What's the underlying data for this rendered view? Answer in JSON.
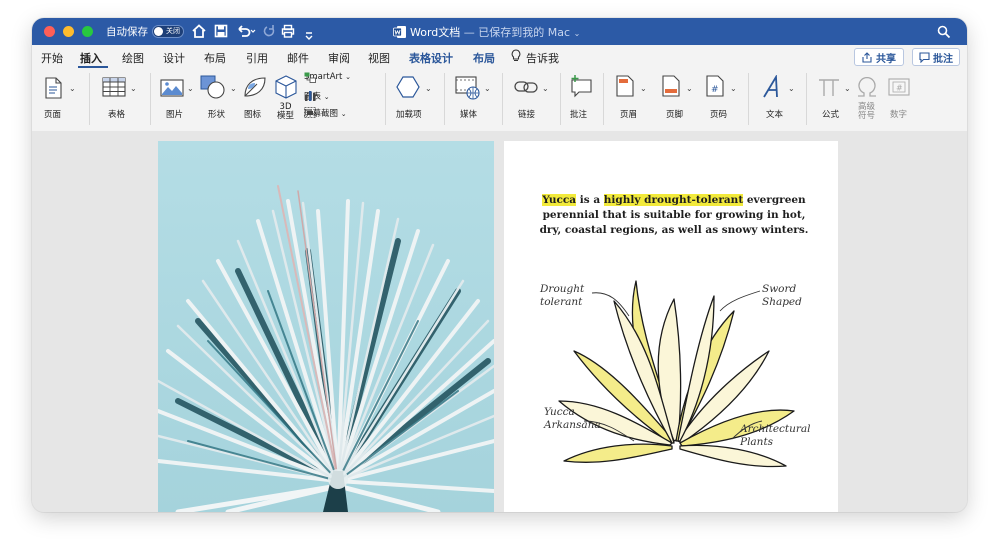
{
  "titlebar": {
    "autosave_label": "自动保存",
    "autosave_toggle": "关闭",
    "doc_name": "Word文档",
    "doc_status": " — 已保存到我的 Mac",
    "colors": {
      "bar": "#2c5aa6",
      "close": "#ff5f57",
      "minimize": "#febc2e",
      "zoom": "#28c840"
    }
  },
  "tabs": [
    {
      "label": "开始"
    },
    {
      "label": "插入"
    },
    {
      "label": "绘图"
    },
    {
      "label": "设计"
    },
    {
      "label": "布局"
    },
    {
      "label": "引用"
    },
    {
      "label": "邮件"
    },
    {
      "label": "审阅"
    },
    {
      "label": "视图"
    },
    {
      "label": "表格设计"
    },
    {
      "label": "布局"
    },
    {
      "label": "告诉我"
    }
  ],
  "actions": {
    "share": "共享",
    "comment": "批注"
  },
  "ribbon": {
    "page": "页面",
    "table": "表格",
    "picture": "图片",
    "shape": "形状",
    "icon": "图标",
    "model3d": "3D\n模型",
    "smartart": "SmartArt",
    "chart": "图表",
    "screenshot": "屏幕截图",
    "addins": "加载项",
    "media": "媒体",
    "link": "链接",
    "comment": "批注",
    "header": "页眉",
    "footer": "页脚",
    "pagenum": "页码",
    "text": "文本",
    "equation": "公式",
    "symbol": "高级\n符号",
    "number": "数字"
  },
  "document": {
    "quote_parts": {
      "p1": "Yucca",
      "p2": " is a ",
      "p3": "highly drought-tolerant",
      "p4": " evergreen perennial that is suitable for growing in hot, dry, coastal regions, as well as snowy winters."
    },
    "notes": {
      "drought": "Drought\ntolerant",
      "sword": "Sword\nShaped",
      "yucca": "Yucca\nArkansana",
      "arch": "Architectural\nPlants"
    },
    "highlight_color": "#f2ea3b"
  }
}
